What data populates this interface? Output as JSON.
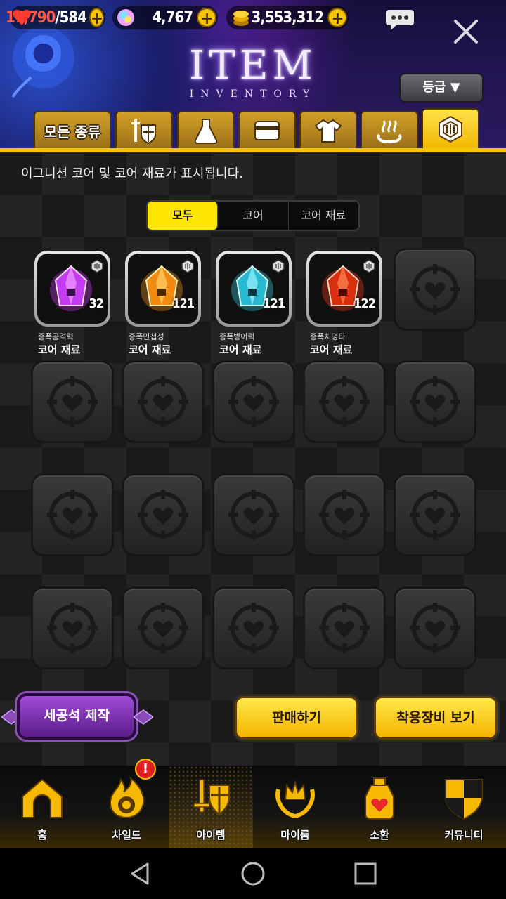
{
  "currency": {
    "energy": "17,790",
    "energy_max": "/584",
    "gems": "4,767",
    "gold": "3,553,312"
  },
  "header": {
    "title": "ITEM",
    "subtitle": "INVENTORY",
    "grade_button": "등급 ▼"
  },
  "category_tabs": {
    "all_label": "모든 종류",
    "icons": [
      "armor-icon",
      "potion-icon",
      "card-icon",
      "clothing-icon",
      "hot-spring-icon",
      "core-icon"
    ],
    "active_index": 6
  },
  "main": {
    "description": "이그니션 코어 및 코어 재료가 표시됩니다.",
    "filter": [
      "모두",
      "코어",
      "코어 재료"
    ],
    "filter_active": "모두"
  },
  "items": [
    {
      "sub": "증폭공격력",
      "name": "코어 재료",
      "count": "32",
      "color": "#d83cff"
    },
    {
      "sub": "증폭민첩성",
      "name": "코어 재료",
      "count": "121",
      "color": "#ff9a1a"
    },
    {
      "sub": "증폭방어력",
      "name": "코어 재료",
      "count": "121",
      "color": "#3ad6e8"
    },
    {
      "sub": "증폭치명타",
      "name": "코어 재료",
      "count": "122",
      "color": "#ff3a1a"
    }
  ],
  "buttons": {
    "craft": "세공석 제작",
    "sell": "판매하기",
    "view_equipped": "착용장비 보기"
  },
  "nav": {
    "items": [
      "홈",
      "차일드",
      "아이템",
      "마이룸",
      "소환",
      "커뮤니티"
    ],
    "active": "아이템",
    "alert": "!"
  }
}
